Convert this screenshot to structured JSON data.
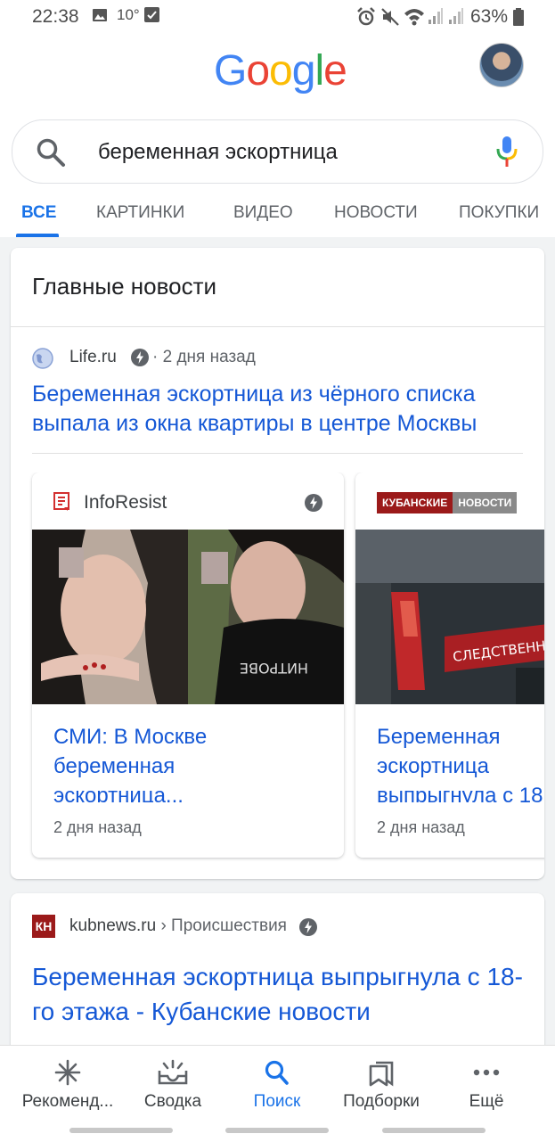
{
  "status_bar": {
    "time": "22:38",
    "temp": "10°",
    "battery": "63%"
  },
  "header": {
    "logo": [
      "G",
      "o",
      "o",
      "g",
      "l",
      "e"
    ]
  },
  "search": {
    "query": "беременная эскортница"
  },
  "tabs": [
    "ВСЕ",
    "КАРТИНКИ",
    "ВИДЕО",
    "НОВОСТИ",
    "ПОКУПКИ"
  ],
  "top_stories": {
    "title": "Главные новости",
    "lead": {
      "source": "Life.ru",
      "time": "· 2 дня назад",
      "headline": "Беременная эскортница из чёрного списка выпала из окна квартиры в центре Москвы"
    },
    "cards": [
      {
        "publisher": "InfoResist",
        "title_lines": [
          "СМИ: В Москве",
          "беременная",
          "эскортница..."
        ],
        "time": "2 дня назад"
      },
      {
        "publisher_logo_a": "КУБАНСКИЕ",
        "publisher_logo_b": "НОВОСТИ",
        "title_lines": [
          "Беременная",
          "эскортница",
          "выпрыгнула с 18"
        ],
        "time": "2 дня назад"
      }
    ]
  },
  "result": {
    "logo": "КН",
    "domain": "kubnews.ru",
    "crumb": "› Происшествия",
    "headline": "Беременная эскортница выпрыгнула с 18-го этажа - Кубанские новости"
  },
  "bottom_nav": [
    {
      "label": "Рекоменд...",
      "icon": "asterisk-icon"
    },
    {
      "label": "Сводка",
      "icon": "inbox-sparkle-icon"
    },
    {
      "label": "Поиск",
      "icon": "search-icon"
    },
    {
      "label": "Подборки",
      "icon": "collections-icon"
    },
    {
      "label": "Ещё",
      "icon": "more-icon"
    }
  ],
  "colors": {
    "accent": "#1a73e8",
    "link": "#1558d6"
  }
}
